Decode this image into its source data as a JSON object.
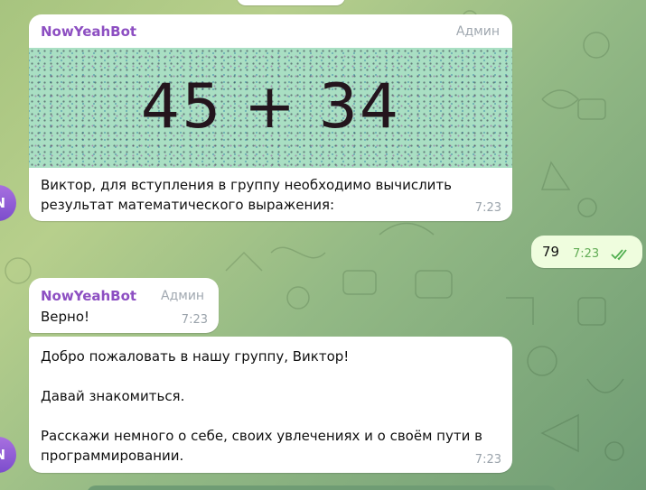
{
  "messages": [
    {
      "sender": "NowYeahBot",
      "role": "Админ",
      "text_line1": "Виктор, для вступления в группу необходимо вычислить",
      "text_line2": "результат математического выражения:",
      "time": "7:23",
      "captcha": "45 + 34"
    },
    {
      "text": "79",
      "time": "7:23",
      "status_icon": "double-check-icon"
    },
    {
      "sender": "NowYeahBot",
      "role": "Админ",
      "text": "Верно!",
      "time": "7:23"
    },
    {
      "line1": "Добро пожаловать в нашу группу, Виктор!",
      "line2": "Давай знакомиться.",
      "line3a": "Расскажи немного о себе, своих увлечениях и о своём пути в",
      "line3b": "программировании.",
      "time": "7:23"
    }
  ],
  "avatar": {
    "initial": "N",
    "color": "#8b5ad6"
  },
  "colors": {
    "sender_name": "#8d4fc2",
    "outgoing_bubble": "#effdde",
    "read_check": "#4fae4e"
  }
}
